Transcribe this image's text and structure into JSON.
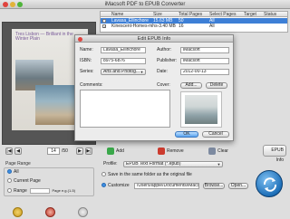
{
  "window": {
    "title": "iMacsoft PDF to EPUB Converter",
    "colors": {
      "close": "#e0443e",
      "minimize": "#e2b33a",
      "zoom": "#4fb43a",
      "accent": "#1d6fb8"
    }
  },
  "preview": {
    "cover_title": "Tres Lisbon — Brilliant in the Winter Plain",
    "current_page": "14",
    "total_pages": "/50",
    "nav": {
      "first": "|◀",
      "prev": "◀",
      "next": "▶",
      "last": "▶|"
    }
  },
  "page_range": {
    "title": "Page Range",
    "options": [
      "All",
      "Current Page",
      "Range"
    ],
    "selected": "All",
    "range_hint": "Page e.g.(1-5)"
  },
  "file_table": {
    "columns": [
      "Name",
      "Size",
      "Total Pages",
      "Select Pages",
      "Target",
      "Status"
    ],
    "rows": [
      {
        "checked": true,
        "name": "Lavasa_Ellinchore",
        "size": "15.63 MB",
        "total_pages": "50",
        "select_pages": "All",
        "target": "",
        "status": ""
      },
      {
        "checked": true,
        "name": "Kinescent-Homes-mhs-3.40 MB",
        "size": "",
        "total_pages": "16",
        "select_pages": "All",
        "target": "",
        "status": ""
      }
    ]
  },
  "dialog": {
    "title": "Edit EPUB Info",
    "name_label": "Name:",
    "name_value": "Lavasa_Ellinchore",
    "isbn_label": "ISBN:",
    "isbn_value": "8975-6876",
    "series_label": "Series:",
    "series_value": "Arts and Photog...",
    "comments_label": "Comments:",
    "author_label": "Author:",
    "author_value": "iMacsoft",
    "publisher_label": "Publisher:",
    "publisher_value": "iMacsoft",
    "date_label": "Date:",
    "date_value": "2012-00-13",
    "cover_label": "Cover:",
    "add_label": "Add...",
    "delete_label": "Delete",
    "ok_label": "OK",
    "cancel_label": "Cancel"
  },
  "actions": {
    "add_label": "Add",
    "remove_label": "Remove",
    "clear_label": "Clear",
    "epub_info_label": "EPUB Info"
  },
  "output": {
    "profile_label": "Profile:",
    "profile_value": "EPUB Text Format (*.epub)",
    "same_folder_label": "Save in the same folder as the original file",
    "customize_label": "Customize",
    "customize_path": "/Users/apple/Documents/iMacs",
    "browse_label": "Browse...",
    "open_label": "Open..."
  }
}
